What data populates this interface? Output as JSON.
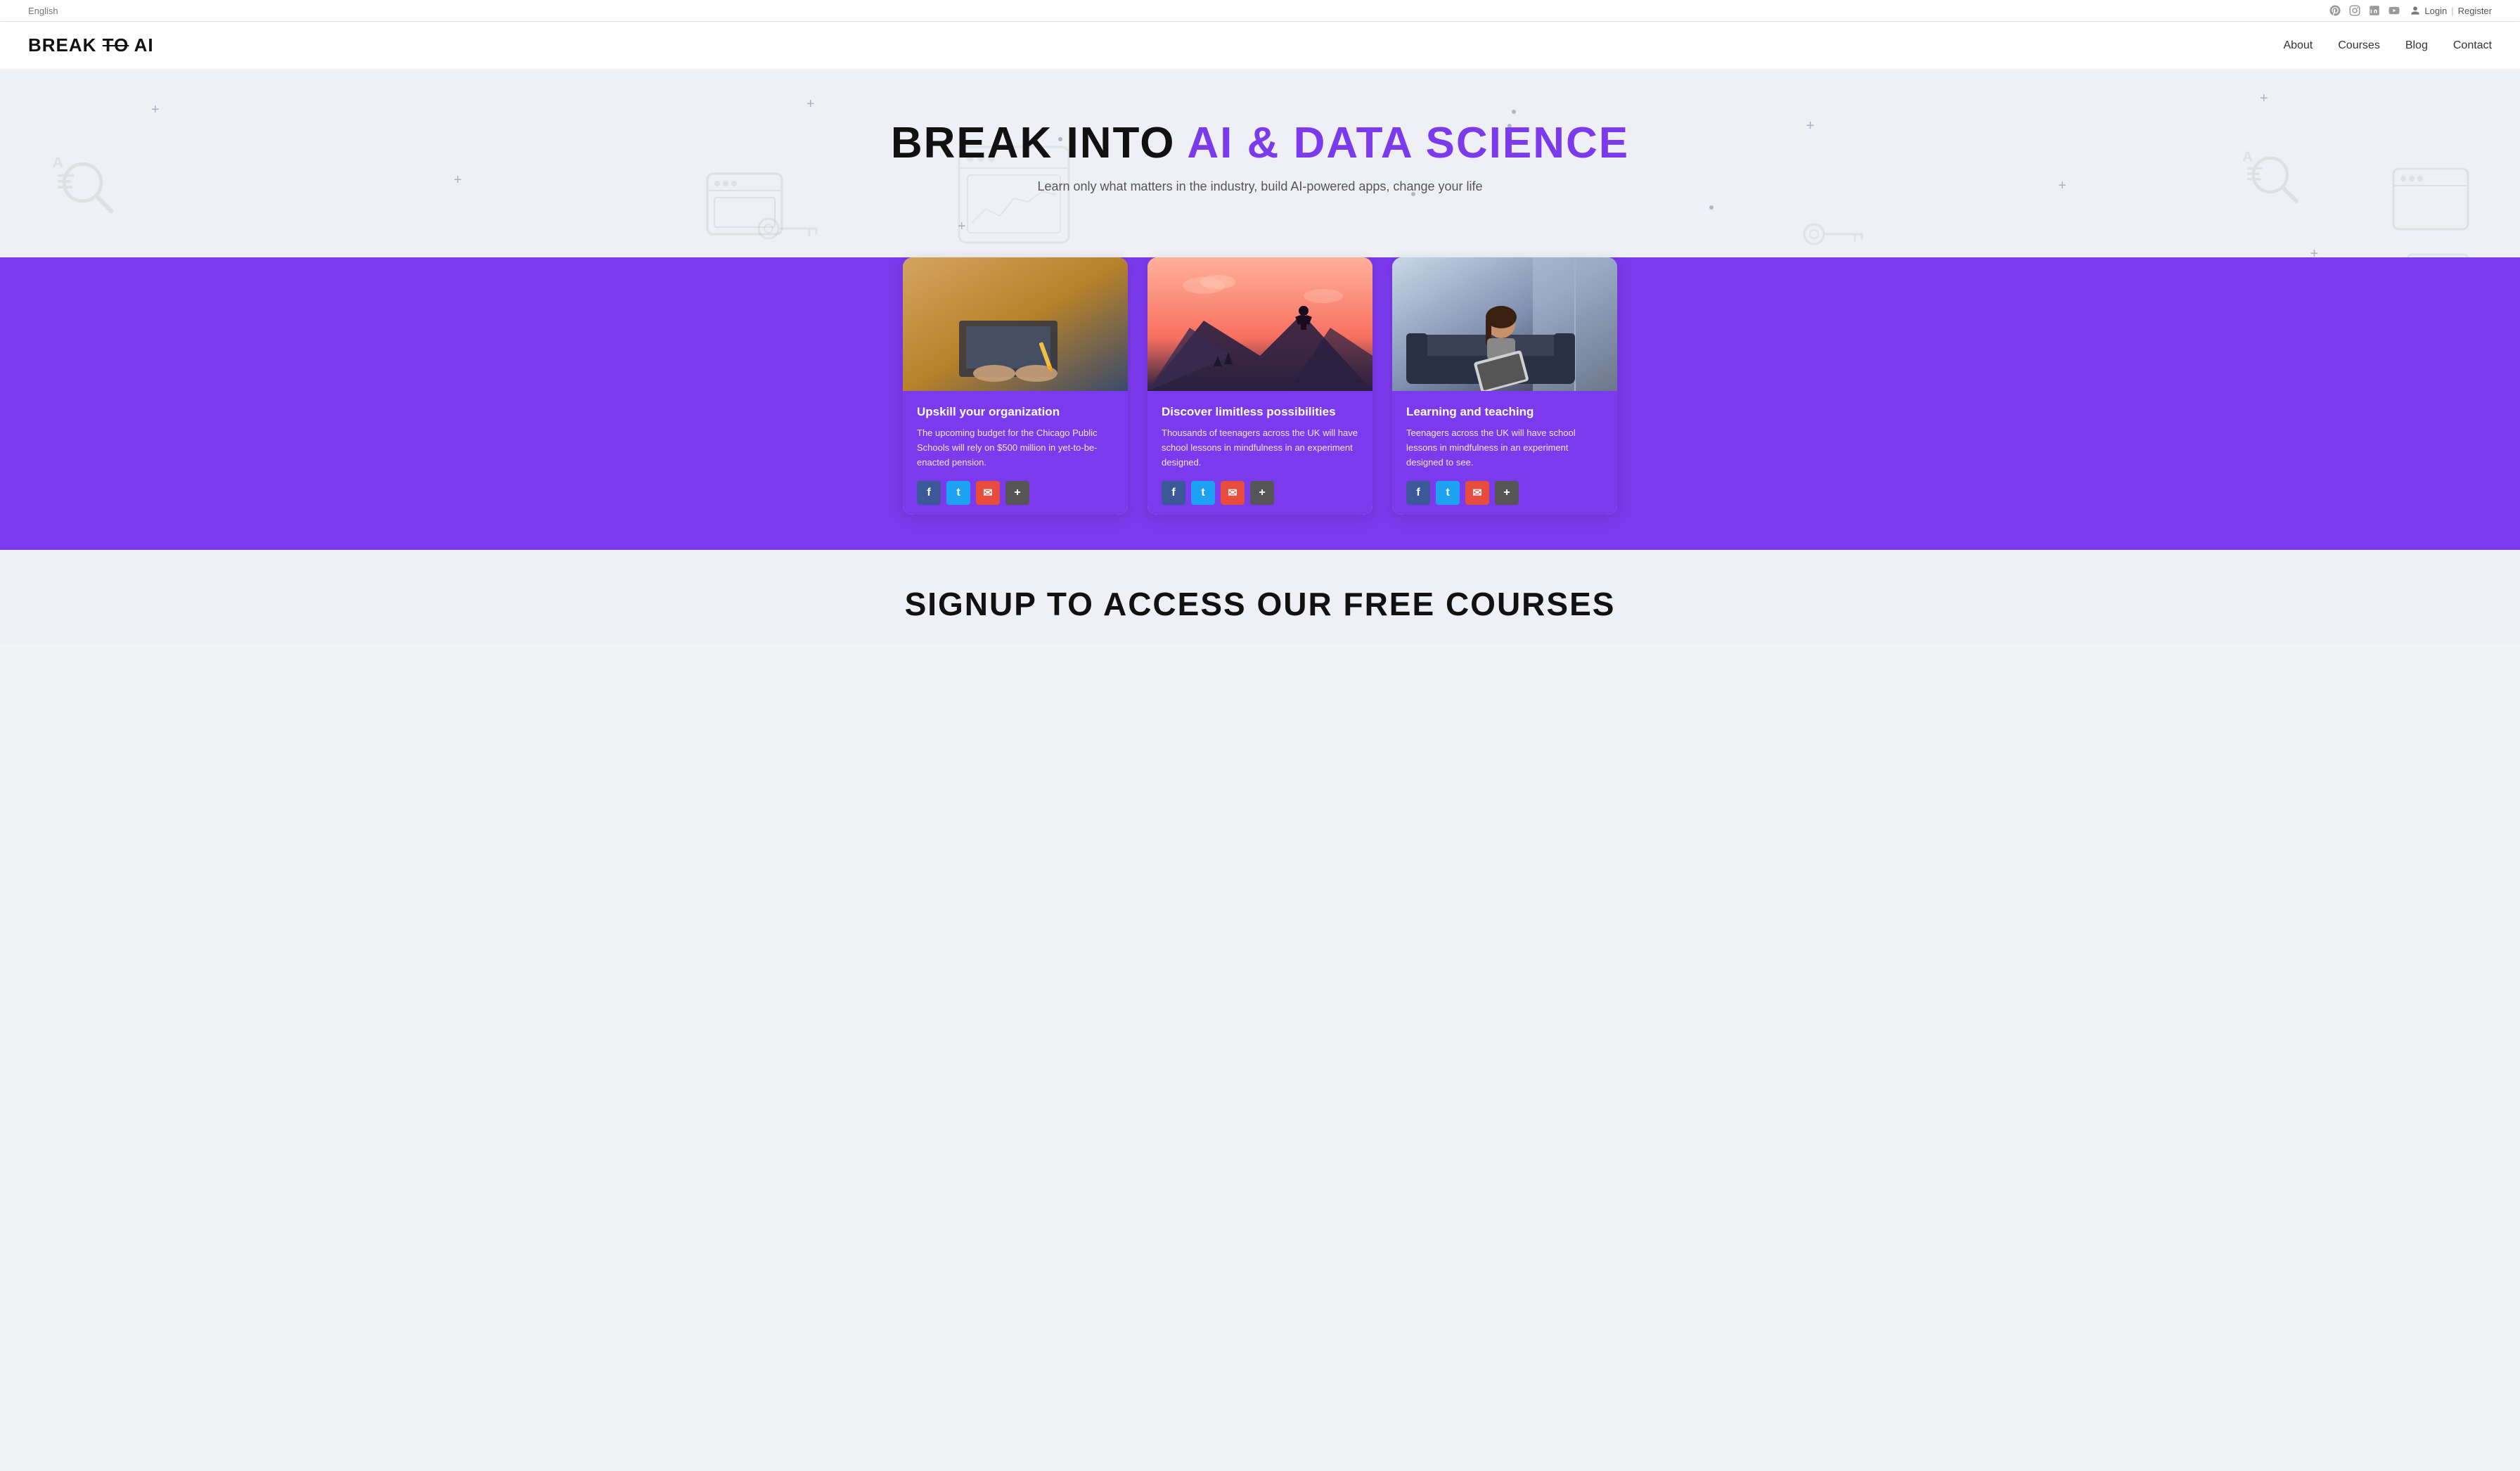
{
  "topbar": {
    "language": "English",
    "auth": {
      "login": "Login",
      "separator": "|",
      "register": "Register"
    }
  },
  "navbar": {
    "logo": {
      "part1": "BREAK",
      "part2": "TO",
      "part3": "AI"
    },
    "links": [
      {
        "label": "About",
        "href": "#"
      },
      {
        "label": "Courses",
        "href": "#"
      },
      {
        "label": "Blog",
        "href": "#"
      },
      {
        "label": "Contact",
        "href": "#"
      }
    ]
  },
  "hero": {
    "title_black": "BREAK INTO",
    "title_accent": "AI & DATA SCIENCE",
    "subtitle": "Learn only what matters in the industry, build AI-powered apps, change your life"
  },
  "cards": [
    {
      "title": "Upskill your organization",
      "description": "The upcoming budget for the Chicago Public Schools will rely on $500 million in yet-to-be-enacted pension.",
      "share_buttons": [
        "f",
        "t",
        "✉",
        "+"
      ]
    },
    {
      "title": "Discover limitless possibilities",
      "description": "Thousands of teenagers across the UK will have school lessons in mindfulness in an experiment designed.",
      "share_buttons": [
        "f",
        "t",
        "✉",
        "+"
      ]
    },
    {
      "title": "Learning and teaching",
      "description": "Teenagers across the UK will have school lessons in mindfulness in an experiment designed to see.",
      "share_buttons": [
        "f",
        "t",
        "✉",
        "+"
      ]
    }
  ],
  "signup": {
    "title": "SIGNUP TO ACCESS OUR FREE COURSES"
  },
  "share_labels": {
    "facebook": "f",
    "twitter": "t",
    "email": "✉",
    "more": "+"
  }
}
